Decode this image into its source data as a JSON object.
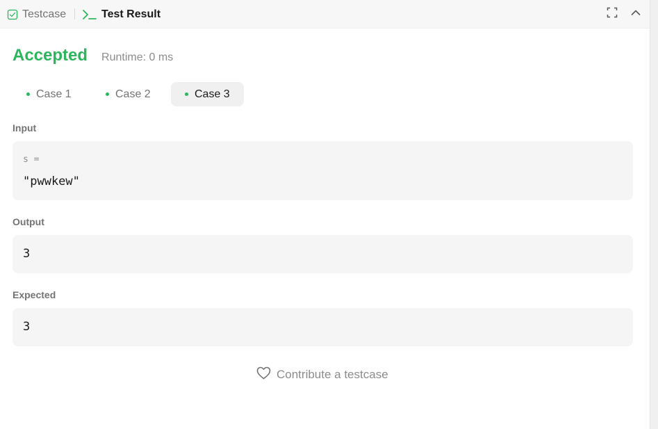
{
  "header": {
    "tabs": [
      {
        "label": "Testcase",
        "icon": "checkbox-icon",
        "active": false
      },
      {
        "label": "Test Result",
        "icon": "terminal-icon",
        "active": true
      }
    ],
    "icons": [
      "expand-icon",
      "chevron-up-icon"
    ]
  },
  "status": {
    "result": "Accepted",
    "runtime": "Runtime: 0 ms"
  },
  "cases": [
    {
      "label": "Case 1",
      "passed": true
    },
    {
      "label": "Case 2",
      "passed": true
    },
    {
      "label": "Case 3",
      "passed": true,
      "selected": true
    }
  ],
  "input": {
    "label": "Input",
    "var_name": "s =",
    "value": "\"pwwkew\""
  },
  "output": {
    "label": "Output",
    "value": "3"
  },
  "expected": {
    "label": "Expected",
    "value": "3"
  },
  "contribute": {
    "label": "Contribute a testcase",
    "icon": "heart-icon"
  },
  "colors": {
    "accent_green": "#2db55d",
    "muted_text": "#8c8c8c",
    "box_bg": "#f5f5f5"
  }
}
